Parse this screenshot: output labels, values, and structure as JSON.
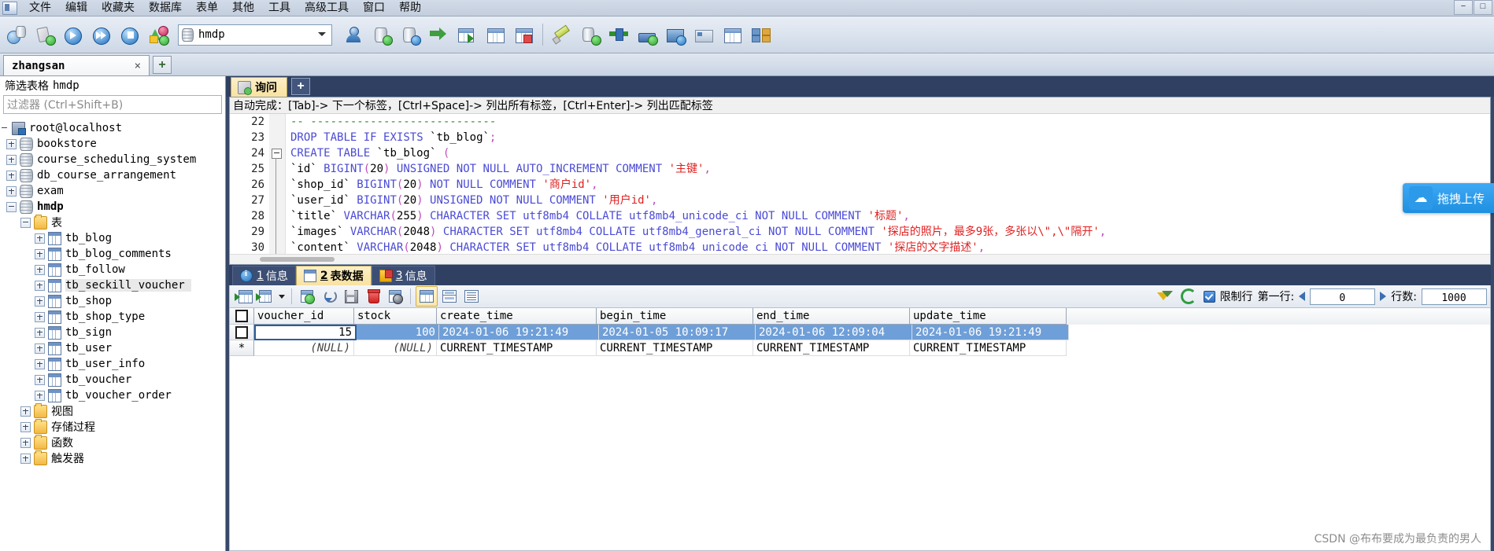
{
  "window": {
    "minimize": "−",
    "maximize": "□",
    "close": "×"
  },
  "menubar": {
    "items": [
      {
        "label": "文件"
      },
      {
        "label": "编辑"
      },
      {
        "label": "收藏夹"
      },
      {
        "label": "数据库"
      },
      {
        "label": "表单"
      },
      {
        "label": "其他"
      },
      {
        "label": "工具"
      },
      {
        "label": "高级工具"
      },
      {
        "label": "窗口"
      },
      {
        "label": "帮助"
      }
    ]
  },
  "toolbar": {
    "database_value": "hmdp"
  },
  "connection_tabs": {
    "active": "zhangsan",
    "close_label": "×",
    "new_tab_label": "+"
  },
  "sidebar": {
    "filter_title": "筛选表格",
    "filter_title_db": "hmdp",
    "filter_placeholder": "过滤器 (Ctrl+Shift+B)",
    "root": "root@localhost",
    "databases": [
      {
        "label": "bookstore"
      },
      {
        "label": "course_scheduling_system"
      },
      {
        "label": "db_course_arrangement"
      },
      {
        "label": "exam"
      },
      {
        "label": "hmdp"
      }
    ],
    "tables_folder": "表",
    "tables": [
      {
        "label": "tb_blog"
      },
      {
        "label": "tb_blog_comments"
      },
      {
        "label": "tb_follow"
      },
      {
        "label": "tb_seckill_voucher"
      },
      {
        "label": "tb_shop"
      },
      {
        "label": "tb_shop_type"
      },
      {
        "label": "tb_sign"
      },
      {
        "label": "tb_user"
      },
      {
        "label": "tb_user_info"
      },
      {
        "label": "tb_voucher"
      },
      {
        "label": "tb_voucher_order"
      }
    ],
    "other_folders": [
      {
        "label": "视图"
      },
      {
        "label": "存储过程"
      },
      {
        "label": "函数"
      },
      {
        "label": "触发器"
      }
    ]
  },
  "query": {
    "tab_label": "询问",
    "new_tab_label": "+",
    "autocomplete_hint": "自动完成：[Tab]-> 下一个标签，[Ctrl+Space]-> 列出所有标签，[Ctrl+Enter]-> 列出匹配标签",
    "lines": [
      {
        "no": "22",
        "text": "-- ----------------------------"
      },
      {
        "no": "23",
        "text": "DROP TABLE IF EXISTS `tb_blog`;"
      },
      {
        "no": "24",
        "text": "CREATE TABLE `tb_blog`  ("
      },
      {
        "no": "25",
        "text": "  `id` BIGINT(20) UNSIGNED NOT NULL AUTO_INCREMENT COMMENT '主键',"
      },
      {
        "no": "26",
        "text": "  `shop_id` BIGINT(20) NOT NULL COMMENT '商户id',"
      },
      {
        "no": "27",
        "text": "  `user_id` BIGINT(20) UNSIGNED NOT NULL COMMENT '用户id',"
      },
      {
        "no": "28",
        "text": "  `title` VARCHAR(255) CHARACTER SET utf8mb4 COLLATE utf8mb4_unicode_ci NOT NULL COMMENT '标题',"
      },
      {
        "no": "29",
        "text": "  `images` VARCHAR(2048) CHARACTER SET utf8mb4 COLLATE utf8mb4_general_ci NOT NULL COMMENT '探店的照片，最多9张，多张以\\\",\\\"隔开',"
      },
      {
        "no": "30",
        "text": "  `content` VARCHAR(2048) CHARACTER SET utf8mb4 COLLATE utf8mb4 unicode ci NOT NULL COMMENT '探店的文字描述',"
      }
    ]
  },
  "result_tabs": [
    {
      "num": "1",
      "label": "信息",
      "icon": "info-icon",
      "active": false
    },
    {
      "num": "2",
      "label": "表数据",
      "icon": "grid-icon",
      "active": true
    },
    {
      "num": "3",
      "label": "信息",
      "icon": "profile-icon",
      "active": false
    }
  ],
  "grid_toolbar": {
    "limit_rows_label": "限制行",
    "first_row_label": "第一行:",
    "first_row_value": "0",
    "rows_label": "行数:",
    "rows_value": "1000"
  },
  "datagrid": {
    "columns": [
      "voucher_id",
      "stock",
      "create_time",
      "begin_time",
      "end_time",
      "update_time"
    ],
    "rows": [
      {
        "selected": true,
        "cells": [
          "15",
          "100",
          "2024-01-06 19:21:49",
          "2024-01-05 10:09:17",
          "2024-01-06 12:09:04",
          "2024-01-06 19:21:49"
        ]
      },
      {
        "selected": false,
        "marker": "*",
        "cells": [
          "(NULL)",
          "(NULL)",
          "CURRENT_TIMESTAMP",
          "CURRENT_TIMESTAMP",
          "CURRENT_TIMESTAMP",
          "CURRENT_TIMESTAMP"
        ]
      }
    ]
  },
  "upload_widget": {
    "label": "拖拽上传",
    "icon": "cloud-upload-icon"
  },
  "watermark": "CSDN @布布要成为最负责的男人",
  "colors": {
    "accent_blue": "#2d6fc0",
    "tab_active": "#f8e2a0",
    "panel_dark": "#2f4063",
    "selection": "#6f9fd8",
    "keyword": "#4a4ad6",
    "string": "#e02020",
    "comment": "#2d8a2d"
  }
}
